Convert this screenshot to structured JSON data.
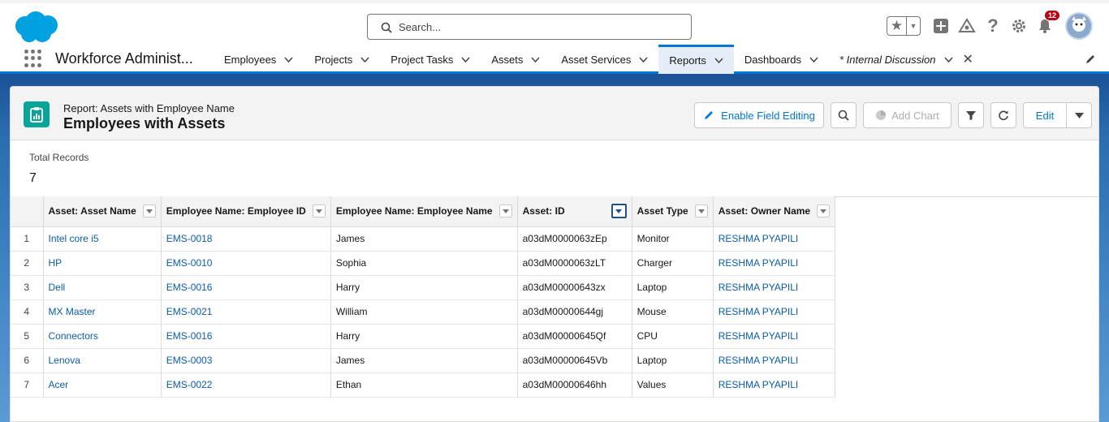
{
  "header": {
    "search_placeholder": "Search...",
    "notification_count": "12"
  },
  "nav": {
    "app_name": "Workforce Administ...",
    "tabs": [
      {
        "label": "Employees"
      },
      {
        "label": "Projects"
      },
      {
        "label": "Project Tasks"
      },
      {
        "label": "Assets"
      },
      {
        "label": "Asset Services"
      },
      {
        "label": "Reports"
      },
      {
        "label": "Dashboards"
      },
      {
        "label": "* Internal Discussion"
      }
    ]
  },
  "report": {
    "subtitle": "Report: Assets with Employee Name",
    "title": "Employees with Assets",
    "actions": {
      "enable_field_editing": "Enable Field Editing",
      "add_chart": "Add Chart",
      "edit": "Edit"
    },
    "total_records_label": "Total Records",
    "total_records_value": "7"
  },
  "table": {
    "columns": [
      "Asset: Asset Name",
      "Employee Name: Employee ID",
      "Employee Name: Employee Name",
      "Asset: ID",
      "Asset Type",
      "Asset: Owner Name"
    ],
    "rows": [
      {
        "n": "1",
        "asset": "Intel core i5",
        "emp_id": "EMS-0018",
        "emp_name": "James",
        "asset_id": "a03dM0000063zEp",
        "type": "Monitor",
        "owner": "RESHMA PYAPILI"
      },
      {
        "n": "2",
        "asset": "HP",
        "emp_id": "EMS-0010",
        "emp_name": "Sophia",
        "asset_id": "a03dM0000063zLT",
        "type": "Charger",
        "owner": "RESHMA PYAPILI"
      },
      {
        "n": "3",
        "asset": "Dell",
        "emp_id": "EMS-0016",
        "emp_name": "Harry",
        "asset_id": "a03dM00000643zx",
        "type": "Laptop",
        "owner": "RESHMA PYAPILI"
      },
      {
        "n": "4",
        "asset": "MX Master",
        "emp_id": "EMS-0021",
        "emp_name": "William",
        "asset_id": "a03dM00000644gj",
        "type": "Mouse",
        "owner": "RESHMA PYAPILI"
      },
      {
        "n": "5",
        "asset": "Connectors",
        "emp_id": "EMS-0016",
        "emp_name": "Harry",
        "asset_id": "a03dM00000645Qf",
        "type": "CPU",
        "owner": "RESHMA PYAPILI"
      },
      {
        "n": "6",
        "asset": "Lenova",
        "emp_id": "EMS-0003",
        "emp_name": "James",
        "asset_id": "a03dM00000645Vb",
        "type": "Laptop",
        "owner": "RESHMA PYAPILI"
      },
      {
        "n": "7",
        "asset": "Acer",
        "emp_id": "EMS-0022",
        "emp_name": "Ethan",
        "asset_id": "a03dM00000646hh",
        "type": "Values",
        "owner": "RESHMA PYAPILI"
      }
    ]
  },
  "colors": {
    "brand_blue": "#0176d3",
    "link_blue": "#0b5cab",
    "report_icon_teal": "#06a59a",
    "badge_red": "#ba0517",
    "salesforce_cloud": "#00a1e0"
  },
  "icons": [
    "salesforce-logo",
    "search-icon",
    "star-icon",
    "add-icon",
    "trailhead-icon",
    "help-icon",
    "gear-icon",
    "bell-icon",
    "avatar",
    "app-launcher-icon",
    "chevron-down-icon",
    "close-icon",
    "pencil-icon",
    "report-icon",
    "filter-icon",
    "refresh-icon",
    "chart-icon"
  ]
}
